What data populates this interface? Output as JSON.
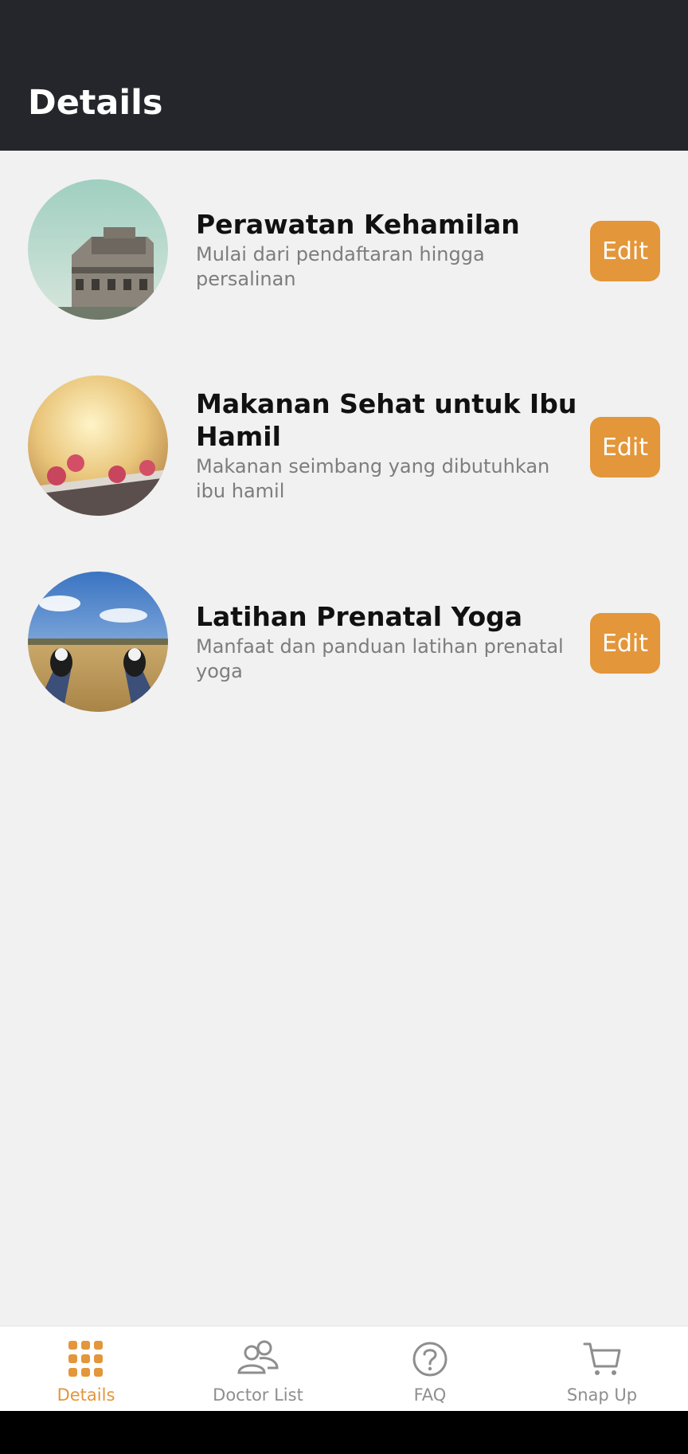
{
  "header": {
    "title": "Details"
  },
  "items": [
    {
      "title": "Perawatan Kehamilan",
      "subtitle": "Mulai dari pendaftaran hingga persalinan",
      "image": "building-photo",
      "edit_label": "Edit"
    },
    {
      "title": "Makanan Sehat untuk Ibu Hamil",
      "subtitle": "Makanan seimbang yang dibutuhkan ibu hamil",
      "image": "raspberries-photo",
      "edit_label": "Edit"
    },
    {
      "title": "Latihan Prenatal Yoga",
      "subtitle": "Manfaat dan panduan latihan prenatal yoga",
      "image": "field-sneakers-photo",
      "edit_label": "Edit"
    }
  ],
  "tabbar": {
    "tabs": [
      {
        "label": "Details",
        "icon": "grid-icon",
        "active": true
      },
      {
        "label": "Doctor List",
        "icon": "people-icon",
        "active": false
      },
      {
        "label": "FAQ",
        "icon": "question-circle-icon",
        "active": false
      },
      {
        "label": "Snap Up",
        "icon": "cart-icon",
        "active": false
      }
    ]
  },
  "colors": {
    "header_bg": "#25262b",
    "accent": "#e3963a",
    "page_bg": "#f1f1f1",
    "inactive_tab": "#8e8e8e"
  }
}
